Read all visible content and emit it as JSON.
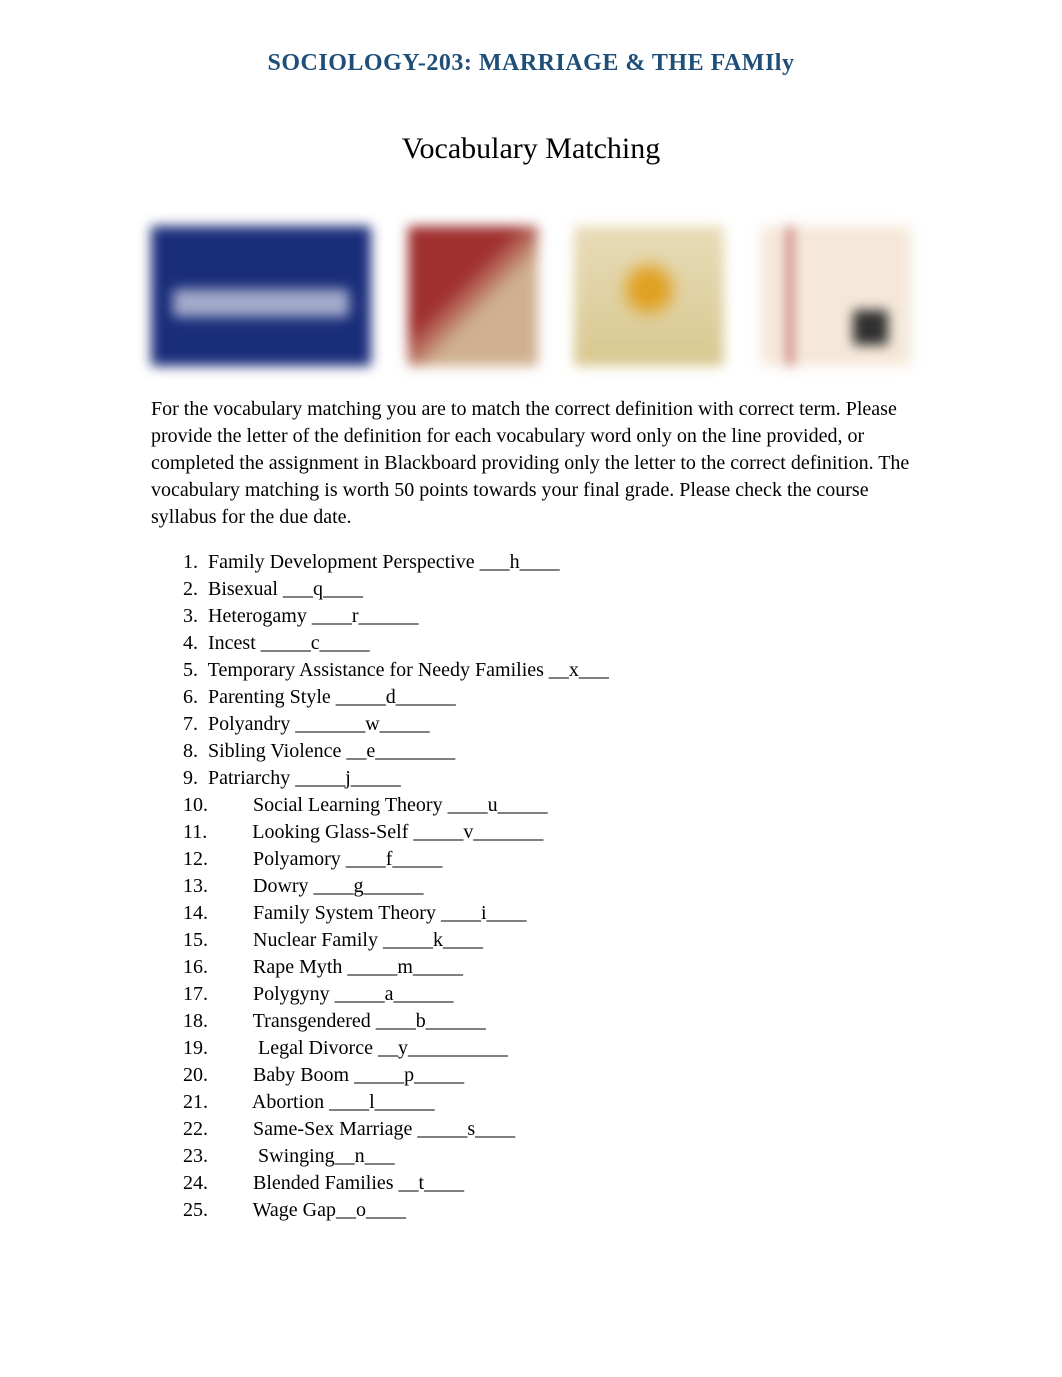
{
  "header": {
    "course_title": "SOCIOLOGY-203: MARRIAGE & THE FAMIly"
  },
  "title": "Vocabulary Matching",
  "instructions": "For the vocabulary matching you are to match the correct definition with correct term. Please provide the letter of the definition for each vocabulary word only on the line provided, or completed the assignment in Blackboard providing only the letter to the correct definition.  The vocabulary matching is worth 50 points towards your final grade.  Please check the course syllabus for the due date.",
  "items": [
    {
      "num": "1.",
      "display": "1.  Family Development Perspective ___h____",
      "term": "Family Development Perspective",
      "answer": "h"
    },
    {
      "num": "2.",
      "display": "2.  Bisexual ___q____",
      "term": "Bisexual",
      "answer": "q"
    },
    {
      "num": "3.",
      "display": "3.  Heterogamy ____r______",
      "term": "Heterogamy",
      "answer": "r"
    },
    {
      "num": "4.",
      "display": "4.  Incest _____c_____",
      "term": "Incest",
      "answer": "c"
    },
    {
      "num": "5.",
      "display": "5.  Temporary Assistance for Needy Families __x___",
      "term": "Temporary Assistance for Needy Families",
      "answer": "x"
    },
    {
      "num": "6.",
      "display": "6.  Parenting Style _____d______",
      "term": "Parenting Style",
      "answer": "d"
    },
    {
      "num": "7.",
      "display": "7.  Polyandry _______w_____",
      "term": "Polyandry",
      "answer": "w"
    },
    {
      "num": "8.",
      "display": "8.  Sibling Violence __e________",
      "term": "Sibling Violence",
      "answer": "e"
    },
    {
      "num": "9.",
      "display": "9.  Patriarchy _____j_____",
      "term": "Patriarchy",
      "answer": "j"
    },
    {
      "num": "10.",
      "display": "10.         Social Learning Theory ____u_____",
      "term": "Social Learning Theory",
      "answer": "u"
    },
    {
      "num": "11.",
      "display": "11.         Looking Glass-Self _____v_______",
      "term": "Looking Glass-Self",
      "answer": "v"
    },
    {
      "num": "12.",
      "display": "12.         Polyamory ____f_____",
      "term": "Polyamory",
      "answer": "f"
    },
    {
      "num": "13.",
      "display": "13.         Dowry ____g______",
      "term": "Dowry",
      "answer": "g"
    },
    {
      "num": "14.",
      "display": "14.         Family System Theory ____i____",
      "term": "Family System Theory",
      "answer": "i"
    },
    {
      "num": "15.",
      "display": "15.         Nuclear Family _____k____",
      "term": "Nuclear Family",
      "answer": "k"
    },
    {
      "num": "16.",
      "display": "16.         Rape Myth _____m_____",
      "term": "Rape Myth",
      "answer": "m"
    },
    {
      "num": "17.",
      "display": "17.         Polygyny _____a______",
      "term": "Polygyny",
      "answer": "a"
    },
    {
      "num": "18.",
      "display": "18.         Transgendered ____b______",
      "term": "Transgendered",
      "answer": "b"
    },
    {
      "num": "19.",
      "display": "19.          Legal Divorce __y__________",
      "term": "Legal Divorce",
      "answer": "y"
    },
    {
      "num": "20.",
      "display": "20.         Baby Boom _____p_____",
      "term": "Baby Boom",
      "answer": "p"
    },
    {
      "num": "21.",
      "display": "21.         Abortion ____l______",
      "term": "Abortion",
      "answer": "l"
    },
    {
      "num": "22.",
      "display": "22.         Same-Sex Marriage _____s____",
      "term": "Same-Sex Marriage",
      "answer": "s"
    },
    {
      "num": "23.",
      "display": "23.          Swinging__n___",
      "term": "Swinging",
      "answer": "n"
    },
    {
      "num": "24.",
      "display": "24.         Blended Families __t____",
      "term": "Blended Families",
      "answer": "t"
    },
    {
      "num": "25.",
      "display": "25.         Wage Gap__o____",
      "term": "Wage Gap",
      "answer": "o"
    }
  ]
}
